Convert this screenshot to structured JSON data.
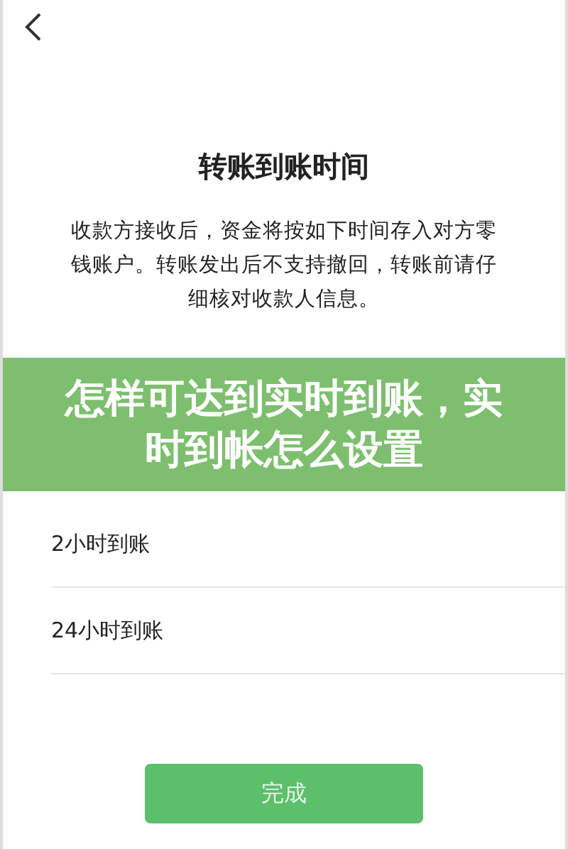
{
  "screen": {
    "title": "转账到账时间",
    "description": "收款方接收后，资金将按如下时间存入对方零钱账户。转账发出后不支持撤回，转账前请仔细核对收款人信息。",
    "options": [
      {
        "label": "2小时到账",
        "selected": false
      },
      {
        "label": "24小时到账",
        "selected": false
      }
    ],
    "button": "完成"
  },
  "banner": {
    "title": "怎样可达到实时到账，实时到帐怎么设置"
  }
}
